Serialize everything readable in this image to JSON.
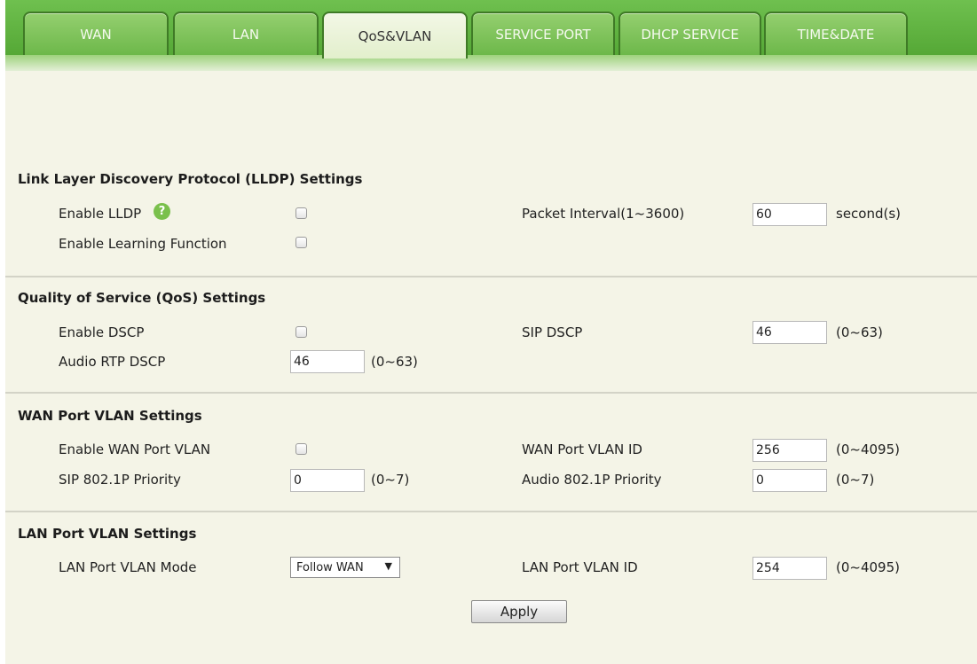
{
  "tabs": [
    {
      "label": "WAN"
    },
    {
      "label": "LAN"
    },
    {
      "label": "QoS&VLAN"
    },
    {
      "label": "SERVICE PORT"
    },
    {
      "label": "DHCP SERVICE"
    },
    {
      "label": "TIME&DATE"
    }
  ],
  "active_tab": "QoS&VLAN",
  "lldp": {
    "title": "Link Layer Discovery Protocol (LLDP) Settings",
    "enable_lldp_label": "Enable LLDP",
    "enable_learning_label": "Enable Learning Function",
    "packet_interval_label": "Packet Interval(1~3600)",
    "packet_interval_value": "60",
    "packet_interval_unit": "second(s)"
  },
  "qos": {
    "title": "Quality of Service (QoS) Settings",
    "enable_dscp_label": "Enable DSCP",
    "sip_dscp_label": "SIP DSCP",
    "sip_dscp_value": "46",
    "sip_dscp_range": "(0~63)",
    "audio_rtp_dscp_label": "Audio RTP DSCP",
    "audio_rtp_dscp_value": "46",
    "audio_rtp_dscp_range": "(0~63)"
  },
  "wan_vlan": {
    "title": "WAN Port VLAN Settings",
    "enable_label": "Enable WAN Port VLAN",
    "vlan_id_label": "WAN Port VLAN ID",
    "vlan_id_value": "256",
    "vlan_id_range": "(0~4095)",
    "sip_priority_label": "SIP 802.1P Priority",
    "sip_priority_value": "0",
    "sip_priority_range": "(0~7)",
    "audio_priority_label": "Audio 802.1P Priority",
    "audio_priority_value": "0",
    "audio_priority_range": "(0~7)"
  },
  "lan_vlan": {
    "title": "LAN Port VLAN Settings",
    "mode_label": "LAN Port VLAN Mode",
    "mode_value": "Follow WAN",
    "vlan_id_label": "LAN Port VLAN ID",
    "vlan_id_value": "254",
    "vlan_id_range": "(0~4095)"
  },
  "apply_label": "Apply",
  "icons": {
    "help": "help-icon",
    "dropdown": "chevron-down-icon"
  },
  "colors": {
    "tab_green": "#6db84a",
    "background": "#f4f4e7"
  }
}
